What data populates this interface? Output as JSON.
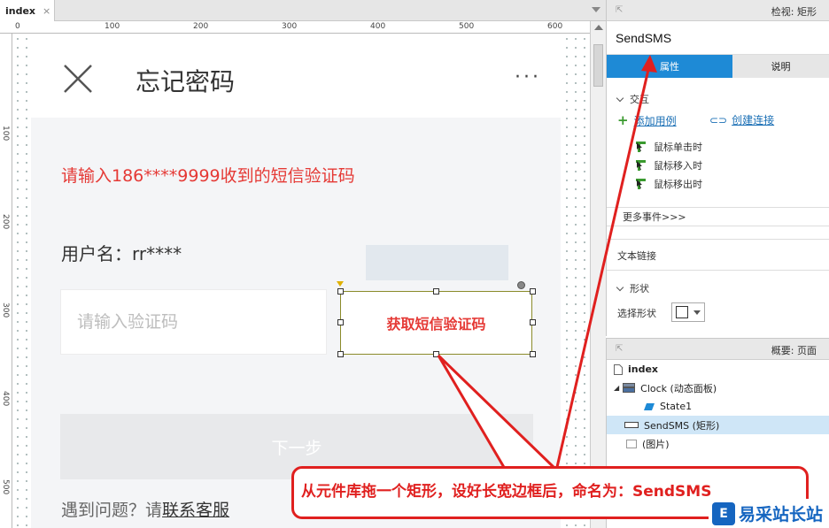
{
  "tab": {
    "name": "index",
    "close": "×"
  },
  "ruler": {
    "top": [
      "0",
      "100",
      "200",
      "300",
      "400",
      "500",
      "600"
    ],
    "left": [
      "100",
      "200",
      "300",
      "400",
      "500"
    ]
  },
  "phone": {
    "title": "忘记密码",
    "more": "···",
    "sms_hint": "请输入186****9999收到的短信验证码",
    "username": "用户名：rr****",
    "code_placeholder": "请输入验证码",
    "sendsms_label": "获取短信验证码",
    "next_label": "下一步",
    "help_prefix": "遇到问题？请",
    "help_link": "联系客服"
  },
  "inspector": {
    "header": "检视: 矩形",
    "widget_name": "SendSMS",
    "tabs": [
      "属性",
      "说明"
    ],
    "interaction_title": "交互",
    "add_case": "添加用例",
    "create_link": "创建连接",
    "events": [
      "鼠标单击时",
      "鼠标移入时",
      "鼠标移出时"
    ],
    "more_events": "更多事件>>>",
    "text_link": "文本链接",
    "shape_title": "形状",
    "shape_select": "选择形状"
  },
  "outline": {
    "header": "概要: 页面",
    "items": [
      {
        "label": "index",
        "icon": "page-icon"
      },
      {
        "label": "Clock (动态面板)",
        "icon": "dynamic-panel-icon"
      },
      {
        "label": "State1",
        "icon": "state-icon"
      },
      {
        "label": "SendSMS (矩形)",
        "icon": "rectangle-icon"
      },
      {
        "label": "(图片)",
        "icon": "image-icon"
      }
    ]
  },
  "annotation": {
    "callout": "从元件库拖一个矩形，设好长宽边框后，命名为：SendSMS"
  },
  "watermark": {
    "text": "易采站长站",
    "logo": "E"
  },
  "colors": {
    "accent_blue": "#1e8ad6",
    "annotation_red": "#e0201f",
    "hint_red": "#e53935"
  }
}
